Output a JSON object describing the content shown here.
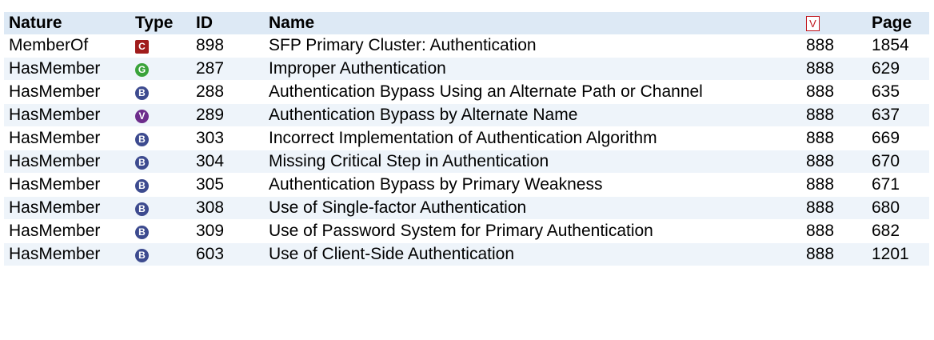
{
  "columns": {
    "nature": "Nature",
    "type": "Type",
    "id": "ID",
    "name": "Name",
    "view_icon": "V",
    "page": "Page"
  },
  "rows": [
    {
      "nature": "MemberOf",
      "type": "C",
      "type_icon": "category-icon",
      "id": "898",
      "name": "SFP Primary Cluster: Authentication",
      "view": "888",
      "page": "1854"
    },
    {
      "nature": "HasMember",
      "type": "G",
      "type_icon": "class-icon",
      "id": "287",
      "name": "Improper Authentication",
      "view": "888",
      "page": "629"
    },
    {
      "nature": "HasMember",
      "type": "B",
      "type_icon": "base-icon",
      "id": "288",
      "name": "Authentication Bypass Using an Alternate Path or Channel",
      "view": "888",
      "page": "635"
    },
    {
      "nature": "HasMember",
      "type": "V",
      "type_icon": "variant-icon",
      "id": "289",
      "name": "Authentication Bypass by Alternate Name",
      "view": "888",
      "page": "637"
    },
    {
      "nature": "HasMember",
      "type": "B",
      "type_icon": "base-icon",
      "id": "303",
      "name": "Incorrect Implementation of Authentication Algorithm",
      "view": "888",
      "page": "669"
    },
    {
      "nature": "HasMember",
      "type": "B",
      "type_icon": "base-icon",
      "id": "304",
      "name": "Missing Critical Step in Authentication",
      "view": "888",
      "page": "670"
    },
    {
      "nature": "HasMember",
      "type": "B",
      "type_icon": "base-icon",
      "id": "305",
      "name": "Authentication Bypass by Primary Weakness",
      "view": "888",
      "page": "671"
    },
    {
      "nature": "HasMember",
      "type": "B",
      "type_icon": "base-icon",
      "id": "308",
      "name": "Use of Single-factor Authentication",
      "view": "888",
      "page": "680"
    },
    {
      "nature": "HasMember",
      "type": "B",
      "type_icon": "base-icon",
      "id": "309",
      "name": "Use of Password System for Primary Authentication",
      "view": "888",
      "page": "682"
    },
    {
      "nature": "HasMember",
      "type": "B",
      "type_icon": "base-icon",
      "id": "603",
      "name": "Use of Client-Side Authentication",
      "view": "888",
      "page": "1201"
    }
  ]
}
